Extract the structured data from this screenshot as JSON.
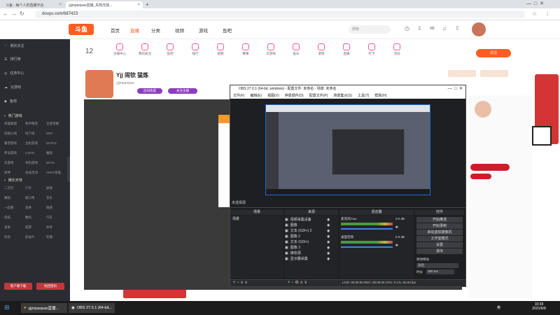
{
  "browser": {
    "tabs": [
      {
        "label": "斗鱼 - 每个人的直播平台",
        "active": false
      },
      {
        "label": "yjjmpaopao直播_失败无损...",
        "active": true
      }
    ],
    "url": "douyu.com/687423",
    "new_tab_symbol": "+"
  },
  "header": {
    "logo": "斗鱼",
    "nav": [
      "首页",
      "直播",
      "分类",
      "视频",
      "游戏",
      "鱼吧"
    ],
    "search_placeholder": "搜索",
    "search_btn": "搜索"
  },
  "sidebar": {
    "items": [
      "我的关注",
      "排行榜",
      "任务中心",
      "云游戏",
      "鱼吧"
    ],
    "section_label": "热门游戏",
    "grid": [
      [
        "英雄联盟",
        "和平精英",
        "王者荣耀"
      ],
      [
        "穿越火线",
        "地下城",
        "DNF"
      ],
      [
        "暴雪游戏",
        "主机游戏",
        "DOTA2"
      ],
      [
        "怀旧游戏",
        "CSGO",
        "魔兽"
      ],
      [
        "云游戏",
        "单机游戏",
        "DOTA"
      ],
      [
        "原神",
        "永劫无间",
        "APEX英雄"
      ]
    ],
    "section2_label": "娱乐天地",
    "grid2": [
      [
        "二次元",
        "户外",
        "颜值"
      ],
      [
        "舞蹈",
        "脱口秀",
        "音乐"
      ],
      [
        "一起看",
        "星秀",
        "情感"
      ],
      [
        "科技",
        "数码",
        "汽车"
      ],
      [
        "美食",
        "旅游",
        "体育"
      ],
      [
        "综合",
        "纪录片",
        "吃播"
      ]
    ],
    "bottom_btns": [
      "客户端下载",
      "找回密码"
    ]
  },
  "main": {
    "categories": [
      {
        "label": "主播中心"
      },
      {
        "label": "我的关注"
      },
      {
        "label": "鱼吧"
      },
      {
        "label": "排行"
      },
      {
        "label": "视频"
      },
      {
        "label": "赛事"
      },
      {
        "label": "云游戏"
      },
      {
        "label": "鱼乐"
      },
      {
        "label": "游戏"
      },
      {
        "label": "直播"
      },
      {
        "label": "打卡"
      },
      {
        "label": "活动"
      }
    ],
    "top_count": "12",
    "streamer": {
      "name": "Yjj 闹钦 猛炼",
      "id_badge": "yjjmpaopao",
      "tags": [
        "房间热度",
        "关注主播"
      ],
      "follow_btn": "关注"
    }
  },
  "obs": {
    "title": "OBS 27.0.1 (64-bit, windows) - 配置文件: 未命名 - 场景: 未命名",
    "menu": [
      "文件(F)",
      "编辑(E)",
      "视图(V)",
      "停靠部件(D)",
      "配置文件(P)",
      "场景集合(S)",
      "工具(T)",
      "帮助(H)"
    ],
    "docks": {
      "scenes": "场景",
      "sources": "来源",
      "mixer": "混音器",
      "transitions": "转场特效",
      "controls": "控件"
    },
    "scene_item": "场景",
    "sources": [
      "视频采集设备",
      "图像",
      "文本 (GDI+) 2",
      "图像 2",
      "文本 (GDI+)",
      "图像 3",
      "媒体源",
      "显示器采集"
    ],
    "mixer": [
      {
        "name": "桌面音频",
        "level": "0.0 dB"
      },
      {
        "name": "麦克风/Aux",
        "level": "0.0 dB"
      }
    ],
    "controls": [
      "开始推流",
      "开始录制",
      "启动虚拟摄像机",
      "工作室模式",
      "设置",
      "退出"
    ],
    "transition": {
      "type": "淡出",
      "duration_label": "时长",
      "duration": "300 ms"
    },
    "status": "LIVE: 00:00:00  REC: 00:00:00  CPU: 0.1%, 60.00 fps",
    "no_source": "未选择源"
  },
  "taskbar": {
    "apps": [
      "yjjmpaopao直播...",
      "OBS 27.0.1 (64-bit..."
    ],
    "time": "10:39",
    "date": "2021/6/8",
    "tray_text": "英"
  },
  "colors": {
    "sidebar_bg": "#2b2c32",
    "accent": "#ff5d23",
    "obs_bg": "#2a2b2f",
    "taskbar": "#1c1c1c"
  }
}
